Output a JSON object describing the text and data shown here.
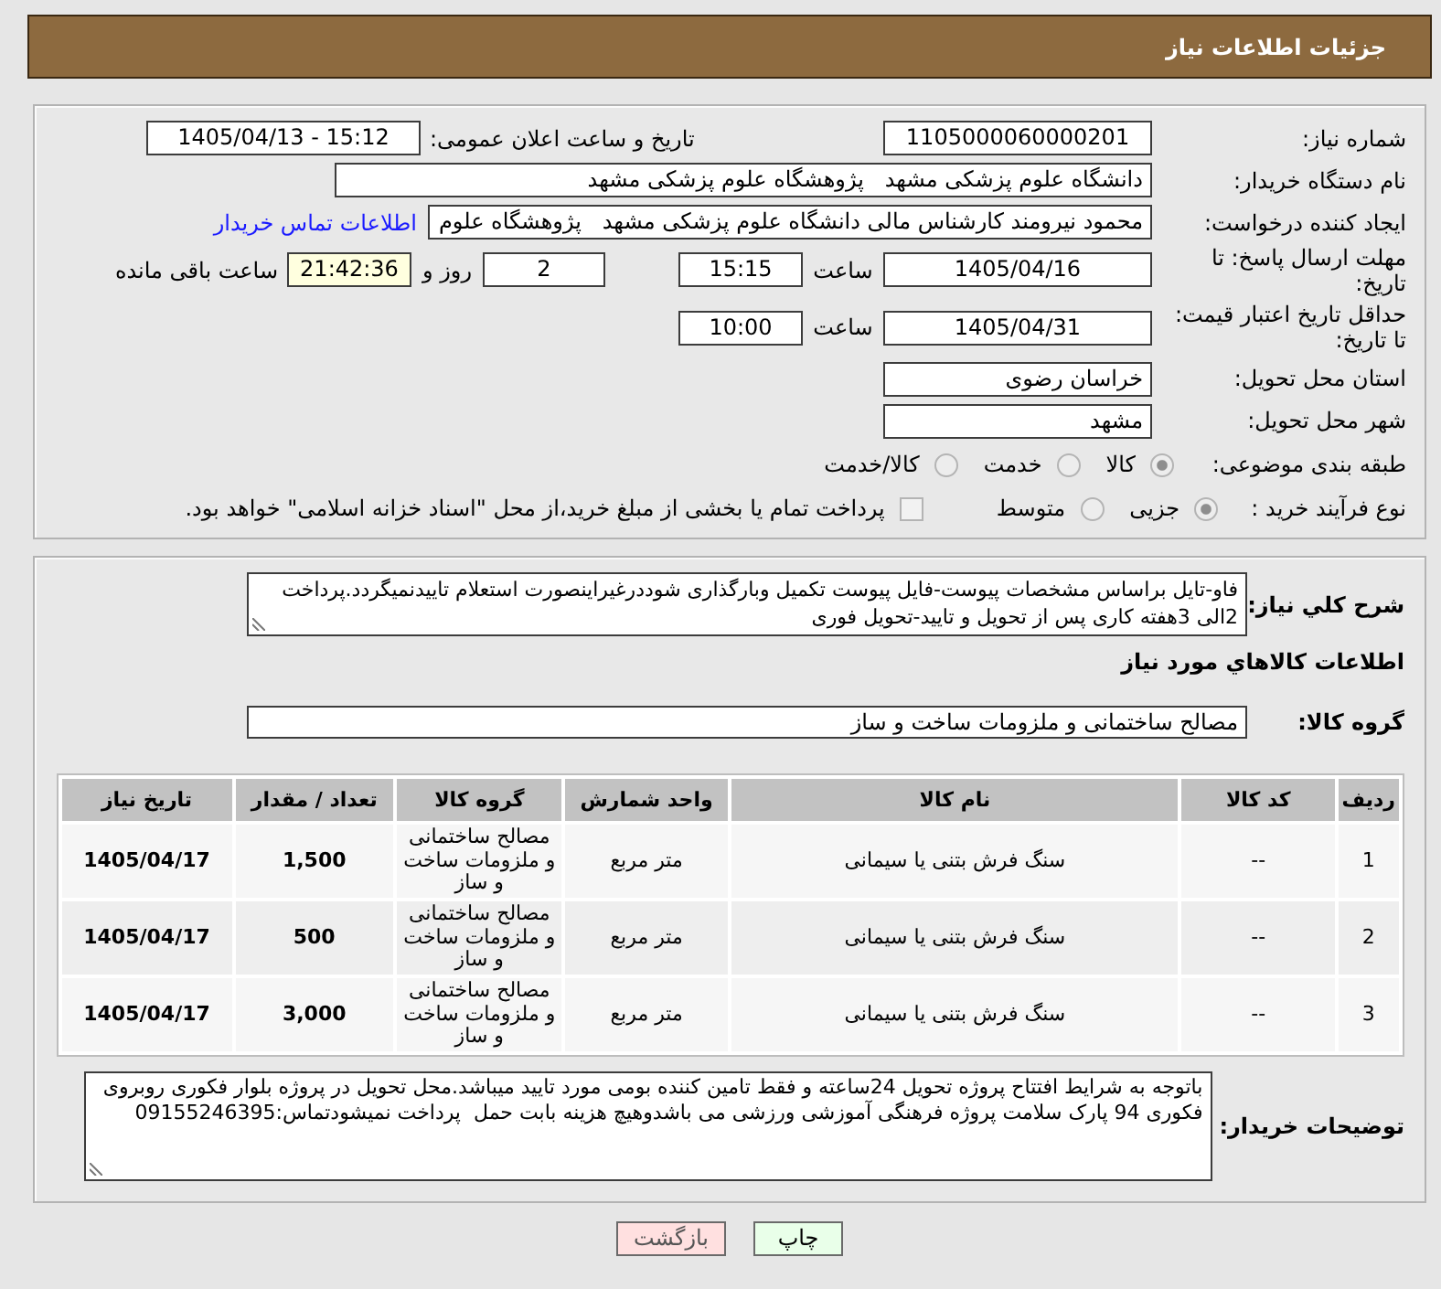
{
  "header": {
    "title": "جزئیات اطلاعات نیاز"
  },
  "need": {
    "number": {
      "label": "شماره نیاز:",
      "value": "1105000060000201"
    },
    "announce": {
      "label": "تاریخ و ساعت اعلان عمومی:",
      "value": "1405/04/13 - 15:12"
    },
    "buyer": {
      "label": "نام دستگاه خریدار:",
      "value": "دانشگاه علوم پزشکی مشهد   پژوهشگاه علوم پزشکی مشهد"
    },
    "requester": {
      "label": "ایجاد کننده درخواست:",
      "value": "محمود نیرومند کارشناس مالی دانشگاه علوم پزشکی مشهد   پژوهشگاه علوم",
      "link": "اطلاعات تماس خریدار"
    },
    "deadline": {
      "label": "مهلت ارسال پاسخ: تا تاریخ:",
      "date": "1405/04/16",
      "time_label": "ساعت",
      "time": "15:15",
      "days": "2",
      "days_label": "روز و",
      "remaining": "21:42:36",
      "remaining_label": "ساعت باقی مانده"
    },
    "validity": {
      "label": "حداقل تاریخ اعتبار قیمت: تا تاریخ:",
      "date": "1405/04/31",
      "time_label": "ساعت",
      "time": "10:00"
    },
    "province": {
      "label": "استان محل تحویل:",
      "value": "خراسان رضوی"
    },
    "city": {
      "label": "شهر محل تحویل:",
      "value": "مشهد"
    },
    "classification": {
      "label": "طبقه بندی موضوعی:",
      "options": [
        {
          "label": "کالا",
          "selected": true
        },
        {
          "label": "خدمت",
          "selected": false
        },
        {
          "label": "کالا/خدمت",
          "selected": false
        }
      ]
    },
    "process": {
      "label": "نوع فرآیند خرید :",
      "options": [
        {
          "label": "جزیی",
          "selected": true
        },
        {
          "label": "متوسط",
          "selected": false
        }
      ],
      "treasury": {
        "label": "پرداخت تمام یا بخشی از مبلغ خرید،از محل \"اسناد خزانه اسلامی\" خواهد بود.",
        "checked": false
      }
    }
  },
  "details": {
    "description": {
      "label": "شرح کلي نياز:",
      "value": "فاو-تایل براساس مشخصات پیوست-فایل پیوست تکمیل وبارگذاری شوددرغیراینصورت استعلام تاییدنمیگردد.پرداخت 2الی 3هفته کاری پس از تحویل و تایید-تحویل فوری"
    },
    "goods_heading": "اطلاعات کالاهاي مورد نياز",
    "goods_group": {
      "label": "گروه کالا:",
      "value": "مصالح ساختمانی و ملزومات ساخت و ساز"
    },
    "table": {
      "columns": [
        "ردیف",
        "کد کالا",
        "نام کالا",
        "واحد شمارش",
        "گروه کالا",
        "تعداد / مقدار",
        "تاریخ نیاز"
      ],
      "rows": [
        [
          "1",
          "--",
          "سنگ فرش بتنی یا سیمانی",
          "متر مربع",
          "مصالح ساختمانی و ملزومات ساخت و ساز",
          "1,500",
          "1405/04/17"
        ],
        [
          "2",
          "--",
          "سنگ فرش بتنی یا سیمانی",
          "متر مربع",
          "مصالح ساختمانی و ملزومات ساخت و ساز",
          "500",
          "1405/04/17"
        ],
        [
          "3",
          "--",
          "سنگ فرش بتنی یا سیمانی",
          "متر مربع",
          "مصالح ساختمانی و ملزومات ساخت و ساز",
          "3,000",
          "1405/04/17"
        ]
      ]
    },
    "buyer_notes": {
      "label": "توضیحات خریدار:",
      "value": "باتوجه به شرایط افتتاح پروژه تحویل 24ساعته و فقط تامین کننده بومی مورد تایید میباشد.محل تحویل در پروژه بلوار فکوری روبروی فکوری 94 پارک سلامت پروژه فرهنگی آموزشی ورزشی می باشدوهیچ هزینه بابت حمل  پرداخت نمیشودتماس:09155246395"
    }
  },
  "buttons": [
    {
      "label": "چاپ",
      "kind": "print"
    },
    {
      "label": "بازگشت",
      "kind": "back"
    }
  ]
}
